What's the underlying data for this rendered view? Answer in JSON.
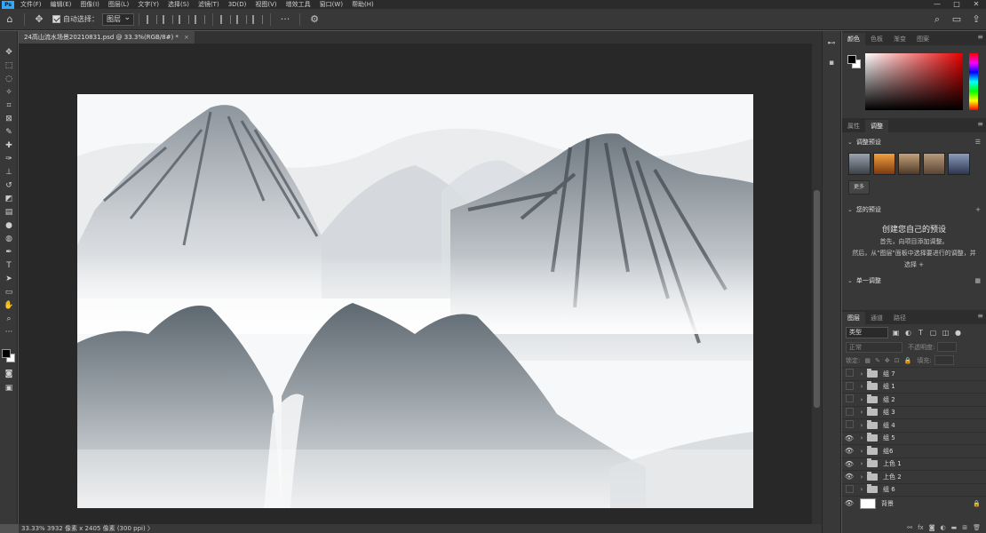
{
  "menubar": {
    "logo": "Ps",
    "items": [
      "文件(F)",
      "编辑(E)",
      "图像(I)",
      "图层(L)",
      "文字(Y)",
      "选择(S)",
      "滤镜(T)",
      "3D(D)",
      "视图(V)",
      "增效工具",
      "窗口(W)",
      "帮助(H)"
    ],
    "window_controls": [
      "—",
      "□",
      "✕"
    ]
  },
  "options": {
    "auto_select_label": "自动选择：",
    "auto_select_target": "图层",
    "auto_select_checked": true,
    "more_label": "···"
  },
  "document": {
    "tab_title": "24高山流水场景20210831.psd @ 33.3%(RGB/8#) *",
    "tab_close": "×"
  },
  "statusbar": {
    "text": "33.33%  3932 像素 x 2405 像素 (300 ppi)  〉"
  },
  "color_panel": {
    "tabs": [
      "颜色",
      "色板",
      "渐变",
      "图案"
    ],
    "foreground": "#000000",
    "background": "#ffffff"
  },
  "adjust_panel": {
    "tabs": [
      "属性",
      "调整"
    ],
    "presets_heading": "调整预设",
    "more_button": "更多",
    "my_presets_heading": "您的预设",
    "create_title": "创建您自己的预设",
    "line1": "首先，向项目添加调整。",
    "line2": "然后，从\"图层\"面板中选择要进行的调整，并",
    "line3": "选择 +",
    "single_adjust_heading": "单一调整"
  },
  "layers_panel": {
    "tabs": [
      "图层",
      "通道",
      "路径"
    ],
    "filter_type": "类型",
    "blend_mode": "正常",
    "opacity_label": "不透明度:",
    "lock_label": "锁定:",
    "fill_label": "填充:",
    "layers": [
      {
        "name": "组 7",
        "visible": false
      },
      {
        "name": "组 1",
        "visible": false
      },
      {
        "name": "组 2",
        "visible": false
      },
      {
        "name": "组 3",
        "visible": false
      },
      {
        "name": "组 4",
        "visible": false
      },
      {
        "name": "组 5",
        "visible": true
      },
      {
        "name": "组6",
        "visible": true
      },
      {
        "name": "上色 1",
        "visible": true
      },
      {
        "name": "上色 2",
        "visible": true
      },
      {
        "name": "组 6",
        "visible": false
      }
    ],
    "background_layer": "背景"
  }
}
